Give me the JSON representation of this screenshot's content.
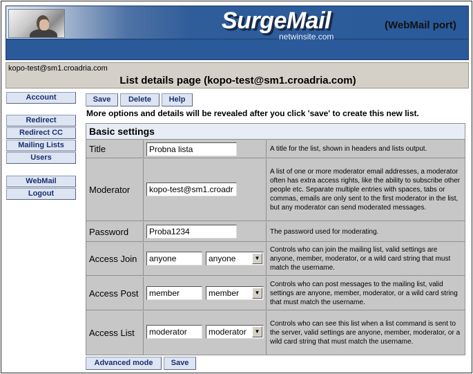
{
  "header": {
    "logo_text": "SurgeMail",
    "logo_subtitle": "netwinsite.com",
    "port_label": "(WebMail port)"
  },
  "user": {
    "email": "kopo-test@sm1.croadria.com",
    "page_title": "List details page (kopo-test@sm1.croadria.com)"
  },
  "sidebar": {
    "items": [
      {
        "label": "Account"
      },
      {
        "label": "Redirect"
      },
      {
        "label": "Redirect CC"
      },
      {
        "label": "Mailing Lists"
      },
      {
        "label": "Users"
      },
      {
        "label": "WebMail"
      },
      {
        "label": "Logout"
      }
    ]
  },
  "toolbar": {
    "save_label": "Save",
    "delete_label": "Delete",
    "help_label": "Help"
  },
  "notice": "More options and details will be revealed after you click 'save' to create this new list.",
  "settings": {
    "heading": "Basic settings",
    "title": {
      "label": "Title",
      "value": "Probna lista",
      "desc": "A title for the list, shown in headers and lists output."
    },
    "moderator": {
      "label": "Moderator",
      "value": "kopo-test@sm1.croadr",
      "desc": "A list of one or more moderator email addresses, a moderator often has extra access rights, like the ability to subscribe other people etc. Separate multiple entries with spaces, tabs or commas, emails are only sent to the first moderator in the list, but any moderator can send moderated messages."
    },
    "password": {
      "label": "Password",
      "value": "Proba1234",
      "desc": "The password used for moderating."
    },
    "access_join": {
      "label": "Access Join",
      "value": "anyone",
      "select": "anyone",
      "desc": "Controls who can join the mailing list, valid settings are anyone, member, moderator, or a wild card string that must match the username."
    },
    "access_post": {
      "label": "Access Post",
      "value": "member",
      "select": "member",
      "desc": "Controls who can post messages to the mailing list, valid settings are anyone, member, moderator, or a wild card string that must match the username."
    },
    "access_list": {
      "label": "Access List",
      "value": "moderator",
      "select": "moderator",
      "desc": "Controls who can see this list when a list command is sent to the server, valid settings are anyone, member, moderator, or a wild card string that must match the username."
    }
  },
  "footer": {
    "advanced_label": "Advanced mode",
    "save_label": "Save"
  }
}
